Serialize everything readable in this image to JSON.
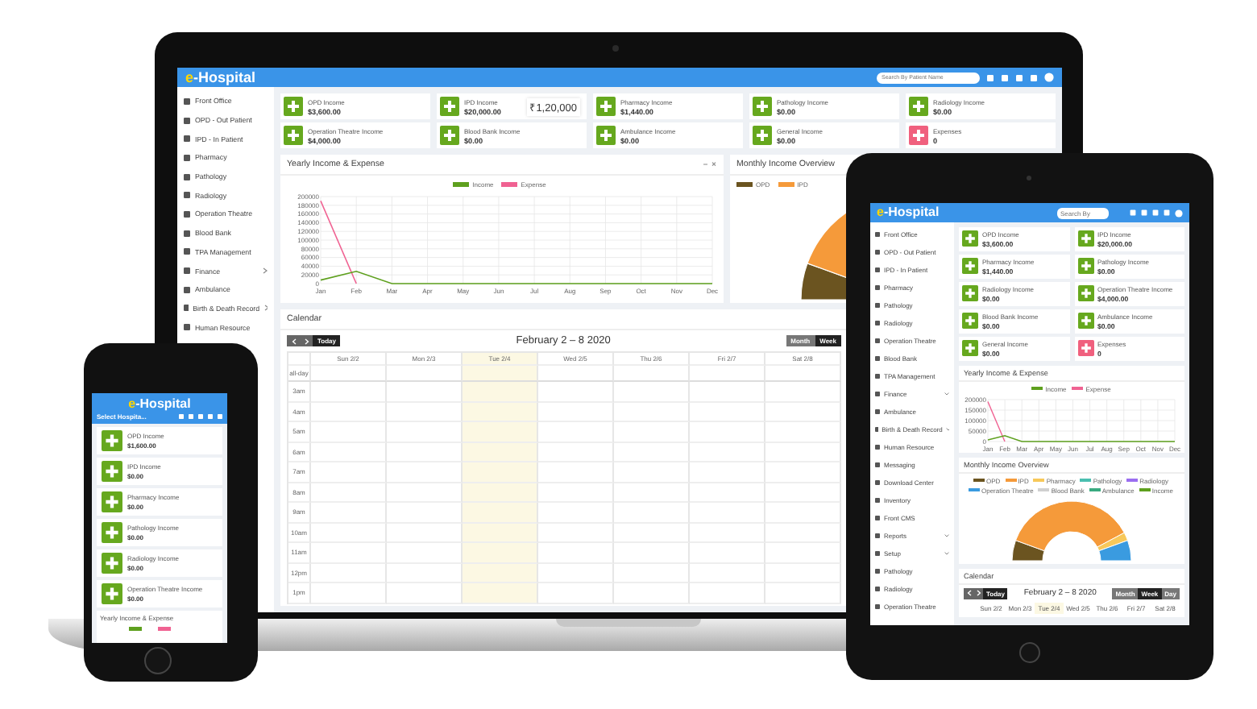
{
  "laptop": {
    "logo": "e-Hospital",
    "search": {
      "placeholder": "Search By Patient Name"
    },
    "sidebar": [
      {
        "label": "Front Office",
        "expandable": false
      },
      {
        "label": "OPD - Out Patient",
        "expandable": false
      },
      {
        "label": "IPD - In Patient",
        "expandable": false
      },
      {
        "label": "Pharmacy",
        "expandable": false
      },
      {
        "label": "Pathology",
        "expandable": false
      },
      {
        "label": "Radiology",
        "expandable": false
      },
      {
        "label": "Operation Theatre",
        "expandable": false
      },
      {
        "label": "Blood Bank",
        "expandable": false
      },
      {
        "label": "TPA Management",
        "expandable": false
      },
      {
        "label": "Finance",
        "expandable": true
      },
      {
        "label": "Ambulance",
        "expandable": false
      },
      {
        "label": "Birth & Death Record",
        "expandable": true
      },
      {
        "label": "Human Resource",
        "expandable": false
      }
    ],
    "cards": [
      {
        "label": "OPD Income",
        "value": "$3,600.00",
        "color": "#66a81e"
      },
      {
        "label": "IPD Income",
        "value": "$20,000.00",
        "color": "#66a81e",
        "tooltip": "₹1,20,000"
      },
      {
        "label": "Pharmacy Income",
        "value": "$1,440.00",
        "color": "#66a81e"
      },
      {
        "label": "Pathology Income",
        "value": "$0.00",
        "color": "#66a81e"
      },
      {
        "label": "Radiology Income",
        "value": "$0.00",
        "color": "#66a81e"
      },
      {
        "label": "Operation Theatre Income",
        "value": "$4,000.00",
        "color": "#66a81e"
      },
      {
        "label": "Blood Bank Income",
        "value": "$0.00",
        "color": "#66a81e"
      },
      {
        "label": "Ambulance Income",
        "value": "$0.00",
        "color": "#66a81e"
      },
      {
        "label": "General Income",
        "value": "$0.00",
        "color": "#66a81e"
      },
      {
        "label": "Expenses",
        "value": "0",
        "color": "#f0607e"
      }
    ],
    "yearly": {
      "chart_data": {
        "type": "line",
        "title": "Yearly Income & Expense",
        "categories": [
          "Jan",
          "Feb",
          "Mar",
          "Apr",
          "May",
          "Jun",
          "Jul",
          "Aug",
          "Sep",
          "Oct",
          "Nov",
          "Dec"
        ],
        "series": [
          {
            "name": "Income",
            "color": "#5ea01e",
            "values": [
              8000,
              28000,
              0,
              0,
              0,
              0,
              0,
              0,
              0,
              0,
              0,
              0
            ]
          },
          {
            "name": "Expense",
            "color": "#f06292",
            "values": [
              190000,
              0,
              null,
              null,
              null,
              null,
              null,
              null,
              null,
              null,
              null,
              null
            ]
          }
        ],
        "ylim": [
          0,
          200000
        ],
        "yticks": [
          0,
          20000,
          40000,
          60000,
          80000,
          100000,
          120000,
          140000,
          160000,
          180000,
          200000
        ],
        "grid": true
      }
    },
    "monthly": {
      "title": "Monthly Income Overview",
      "legend": [
        {
          "label": "OPD",
          "color": "#6b5420"
        },
        {
          "label": "IPD",
          "color": "#f59a3a"
        }
      ]
    },
    "calendar": {
      "title": "Calendar",
      "today": "Today",
      "range": "February 2 – 8 2020",
      "views": [
        {
          "label": "Month",
          "selected": false
        },
        {
          "label": "Week",
          "selected": true
        }
      ],
      "days": [
        {
          "label": "Sun 2/2",
          "today": false
        },
        {
          "label": "Mon 2/3",
          "today": false
        },
        {
          "label": "Tue 2/4",
          "today": true
        },
        {
          "label": "Wed 2/5",
          "today": false
        },
        {
          "label": "Thu 2/6",
          "today": false
        },
        {
          "label": "Fri 2/7",
          "today": false
        },
        {
          "label": "Sat 2/8",
          "today": false
        }
      ],
      "allday": "all-day",
      "times": [
        "3am",
        "4am",
        "5am",
        "6am",
        "7am",
        "8am",
        "9am",
        "10am",
        "11am",
        "12pm",
        "1pm"
      ]
    }
  },
  "tablet": {
    "logo": "e-Hospital",
    "search": {
      "placeholder": "Search By"
    },
    "sidebar": [
      {
        "label": "Front Office",
        "expandable": false
      },
      {
        "label": "OPD - Out Patient",
        "expandable": false
      },
      {
        "label": "IPD - In Patient",
        "expandable": false
      },
      {
        "label": "Pharmacy",
        "expandable": false
      },
      {
        "label": "Pathology",
        "expandable": false
      },
      {
        "label": "Radiology",
        "expandable": false
      },
      {
        "label": "Operation Theatre",
        "expandable": false
      },
      {
        "label": "Blood Bank",
        "expandable": false
      },
      {
        "label": "TPA Management",
        "expandable": false
      },
      {
        "label": "Finance",
        "expandable": true
      },
      {
        "label": "Ambulance",
        "expandable": false
      },
      {
        "label": "Birth & Death Record",
        "expandable": true
      },
      {
        "label": "Human Resource",
        "expandable": false
      },
      {
        "label": "Messaging",
        "expandable": false
      },
      {
        "label": "Download Center",
        "expandable": false
      },
      {
        "label": "Inventory",
        "expandable": false
      },
      {
        "label": "Front CMS",
        "expandable": false
      },
      {
        "label": "Reports",
        "expandable": true
      },
      {
        "label": "Setup",
        "expandable": true
      },
      {
        "label": "Pathology",
        "expandable": false
      },
      {
        "label": "Radiology",
        "expandable": false
      },
      {
        "label": "Operation Theatre",
        "expandable": false
      }
    ],
    "cards": [
      {
        "label": "OPD Income",
        "value": "$3,600.00",
        "color": "#66a81e"
      },
      {
        "label": "IPD Income",
        "value": "$20,000.00",
        "color": "#66a81e"
      },
      {
        "label": "Pharmacy Income",
        "value": "$1,440.00",
        "color": "#66a81e"
      },
      {
        "label": "Pathology Income",
        "value": "$0.00",
        "color": "#66a81e"
      },
      {
        "label": "Radiology Income",
        "value": "$0.00",
        "color": "#66a81e"
      },
      {
        "label": "Operation Theatre Income",
        "value": "$4,000.00",
        "color": "#66a81e"
      },
      {
        "label": "Blood Bank Income",
        "value": "$0.00",
        "color": "#66a81e"
      },
      {
        "label": "Ambulance Income",
        "value": "$0.00",
        "color": "#66a81e"
      },
      {
        "label": "General Income",
        "value": "$0.00",
        "color": "#66a81e"
      },
      {
        "label": "Expenses",
        "value": "0",
        "color": "#f0607e"
      }
    ],
    "yearly": {
      "chart_data": {
        "type": "line",
        "title": "Yearly Income & Expense",
        "categories": [
          "Jan",
          "Feb",
          "Mar",
          "Apr",
          "May",
          "Jun",
          "Jul",
          "Aug",
          "Sep",
          "Oct",
          "Nov",
          "Dec"
        ],
        "series": [
          {
            "name": "Income",
            "color": "#5ea01e",
            "values": [
              8000,
              28000,
              0,
              0,
              0,
              0,
              0,
              0,
              0,
              0,
              0,
              0
            ]
          },
          {
            "name": "Expense",
            "color": "#f06292",
            "values": [
              190000,
              0,
              null,
              null,
              null,
              null,
              null,
              null,
              null,
              null,
              null,
              null
            ]
          }
        ],
        "ylim": [
          0,
          200000
        ],
        "yticks": [
          0,
          50000,
          100000,
          150000,
          200000
        ],
        "grid": true
      }
    },
    "monthly": {
      "title": "Monthly Income Overview",
      "legend": [
        {
          "label": "OPD",
          "color": "#6b5420"
        },
        {
          "label": "IPD",
          "color": "#f59a3a"
        },
        {
          "label": "Pharmacy",
          "color": "#f7c85a"
        },
        {
          "label": "Pathology",
          "color": "#4bbfb0"
        },
        {
          "label": "Radiology",
          "color": "#9b6ef0"
        },
        {
          "label": "Operation Theatre",
          "color": "#3a9be0"
        },
        {
          "label": "Blood Bank",
          "color": "#d0d0d0"
        },
        {
          "label": "Ambulance",
          "color": "#3aaa80"
        },
        {
          "label": "Income",
          "color": "#5ea01e"
        }
      ]
    },
    "calendar": {
      "title": "Calendar",
      "today": "Today",
      "range": "February 2 – 8 2020",
      "views": [
        {
          "label": "Month",
          "selected": false
        },
        {
          "label": "Week",
          "selected": true
        },
        {
          "label": "Day",
          "selected": false
        }
      ],
      "days": [
        {
          "label": "Sun 2/2",
          "today": false
        },
        {
          "label": "Mon 2/3",
          "today": false
        },
        {
          "label": "Tue 2/4",
          "today": true
        },
        {
          "label": "Wed 2/5",
          "today": false
        },
        {
          "label": "Thu 2/6",
          "today": false
        },
        {
          "label": "Fri 2/7",
          "today": false
        },
        {
          "label": "Sat 2/8",
          "today": false
        }
      ]
    }
  },
  "phone": {
    "logo": "e-Hospital",
    "hospital_select": "Select Hospita...",
    "cards": [
      {
        "label": "OPD Income",
        "value": "$1,600.00",
        "color": "#66a81e"
      },
      {
        "label": "IPD Income",
        "value": "$0.00",
        "color": "#66a81e"
      },
      {
        "label": "Pharmacy Income",
        "value": "$0.00",
        "color": "#66a81e"
      },
      {
        "label": "Pathology Income",
        "value": "$0.00",
        "color": "#66a81e"
      },
      {
        "label": "Radiology Income",
        "value": "$0.00",
        "color": "#66a81e"
      },
      {
        "label": "Operation Theatre Income",
        "value": "$0.00",
        "color": "#66a81e"
      }
    ],
    "yearly": {
      "title": "Yearly Income & Expense"
    }
  }
}
